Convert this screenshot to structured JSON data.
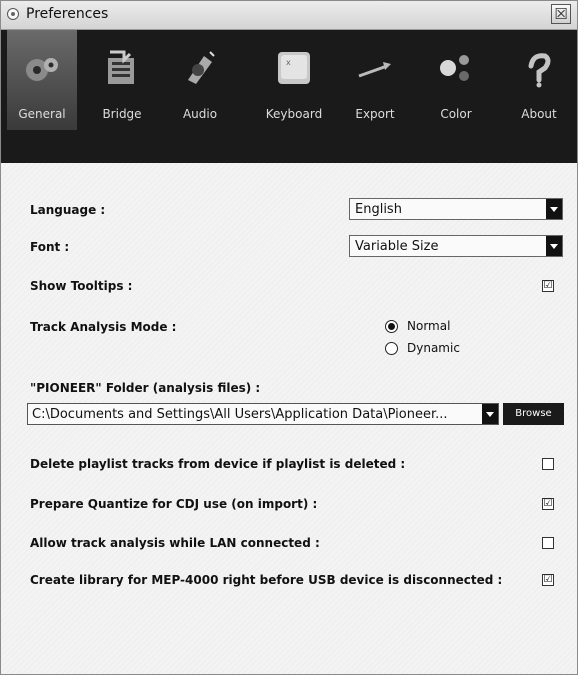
{
  "window": {
    "title": "Preferences",
    "close_glyph": "☒"
  },
  "toolbar": {
    "items": [
      {
        "label": "General",
        "icon": "gears-icon",
        "active": true
      },
      {
        "label": "Bridge",
        "icon": "bridge-icon"
      },
      {
        "label": "Audio",
        "icon": "speaker-icon"
      },
      {
        "label": "Keyboard",
        "icon": "keyboard-key-icon"
      },
      {
        "label": "Export",
        "icon": "export-arrow-icon"
      },
      {
        "label": "Color",
        "icon": "color-balls-icon"
      },
      {
        "label": "About",
        "icon": "about-icon"
      }
    ]
  },
  "settings": {
    "language": {
      "label": "Language :",
      "value": "English"
    },
    "font": {
      "label": "Font :",
      "value": "Variable Size"
    },
    "tooltips": {
      "label": "Show Tooltips :",
      "checked": true
    },
    "analysis_mode": {
      "label": "Track Analysis Mode :",
      "options": [
        "Normal",
        "Dynamic"
      ],
      "selected": "Normal"
    },
    "folder": {
      "label": "\"PIONEER\" Folder (analysis files) :",
      "value": "C:\\Documents and Settings\\All Users\\Application Data\\Pioneer...",
      "browse_label": "Browse"
    },
    "delete_playlist": {
      "label": "Delete playlist tracks from device if playlist is deleted :",
      "checked": false
    },
    "quantize": {
      "label": "Prepare Quantize for CDJ use (on import) :",
      "checked": true
    },
    "lan_analysis": {
      "label": "Allow track analysis while LAN connected :",
      "checked": false
    },
    "mep_library": {
      "label": "Create library for MEP-4000 right before USB device is disconnected :",
      "checked": true
    }
  },
  "check_glyph": "☑"
}
